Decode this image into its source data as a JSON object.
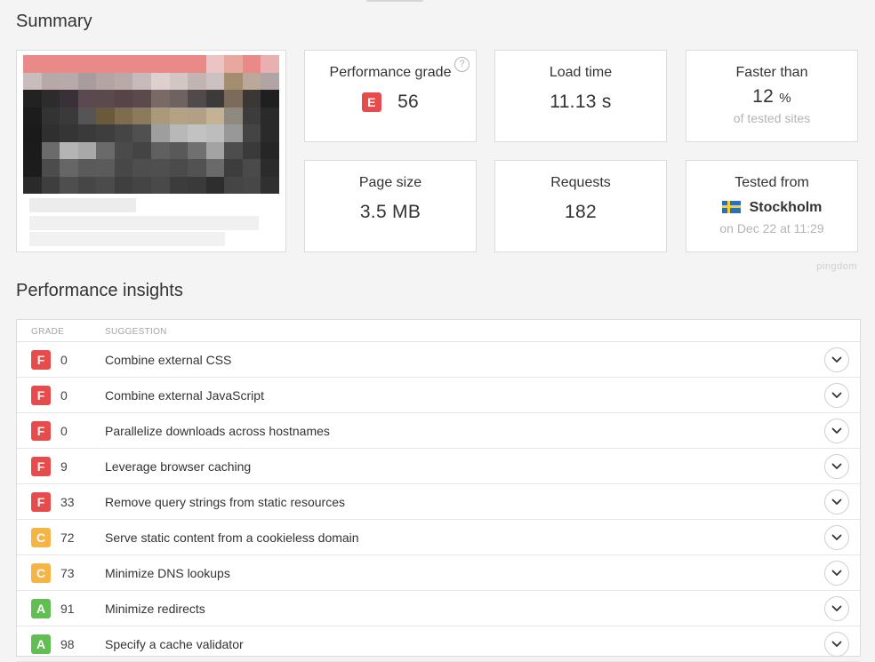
{
  "summary": {
    "title": "Summary",
    "performance_grade": {
      "label": "Performance grade",
      "letter": "E",
      "score": "56",
      "help": "?"
    },
    "load_time": {
      "label": "Load time",
      "value": "11.13 s"
    },
    "faster_than": {
      "label": "Faster than",
      "value": "12",
      "unit": "%",
      "sub": "of tested sites"
    },
    "page_size": {
      "label": "Page size",
      "value": "3.5 MB"
    },
    "requests": {
      "label": "Requests",
      "value": "182"
    },
    "tested_from": {
      "label": "Tested from",
      "location": "Stockholm",
      "date": "on Dec 22 at 11:29",
      "flag": "sweden-flag"
    },
    "brand": "pingdom"
  },
  "insights": {
    "title": "Performance insights",
    "columns": {
      "grade": "GRADE",
      "suggestion": "SUGGESTION"
    },
    "rows": [
      {
        "grade": "F",
        "score": "0",
        "suggestion": "Combine external CSS"
      },
      {
        "grade": "F",
        "score": "0",
        "suggestion": "Combine external JavaScript"
      },
      {
        "grade": "F",
        "score": "0",
        "suggestion": "Parallelize downloads across hostnames"
      },
      {
        "grade": "F",
        "score": "9",
        "suggestion": "Leverage browser caching"
      },
      {
        "grade": "F",
        "score": "33",
        "suggestion": "Remove query strings from static resources"
      },
      {
        "grade": "C",
        "score": "72",
        "suggestion": "Serve static content from a cookieless domain"
      },
      {
        "grade": "C",
        "score": "73",
        "suggestion": "Minimize DNS lookups"
      },
      {
        "grade": "A",
        "score": "91",
        "suggestion": "Minimize redirects"
      },
      {
        "grade": "A",
        "score": "98",
        "suggestion": "Specify a cache validator"
      }
    ]
  },
  "colors": {
    "grade_F": "#e74c4c",
    "grade_E": "#e74c4c",
    "grade_C": "#f5b445",
    "grade_A": "#62bd52"
  }
}
